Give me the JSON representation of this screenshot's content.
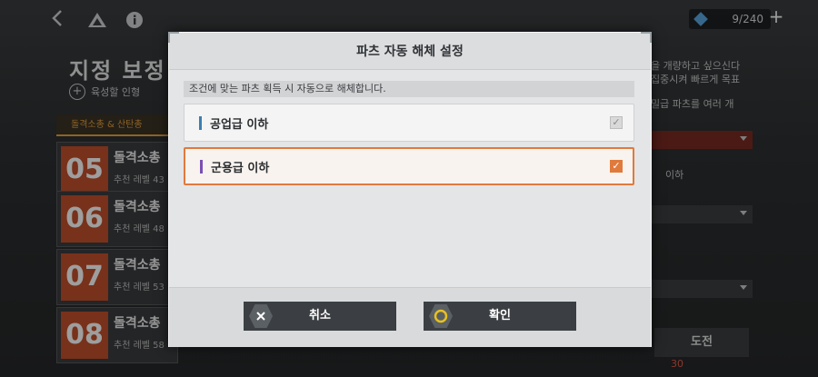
{
  "topbar": {
    "back_icon": "chevron-left-icon",
    "share_icon": "triangle-logo-icon",
    "info_icon": "info-icon",
    "resource_count": "9/240",
    "resource_icon": "gem-icon",
    "plus_icon": "plus-icon"
  },
  "left_panel": {
    "title": "지정 보정",
    "subtitle": "육성할 인형",
    "tab": "돌격소총 & 산탄총",
    "stages": [
      {
        "num": "05",
        "name": "돌격소총",
        "level": "추천 레벨 43"
      },
      {
        "num": "06",
        "name": "돌격소총",
        "level": "추천 레벨 48"
      },
      {
        "num": "07",
        "name": "돌격소총",
        "level": "추천 레벨 53"
      },
      {
        "num": "08",
        "name": "돌격소총",
        "level": "추천 레벨 58"
      }
    ]
  },
  "right_panel": {
    "text1": "을 개량하고 싶으신다",
    "text2": "집중시켜 빠르게 목표",
    "text3": "밀급 파츠를 여러 개",
    "text4": "이하",
    "stamina": "30",
    "start_button": "도전"
  },
  "dialog": {
    "title": "파츠 자동 해체 설정",
    "description": "조건에 맞는 파츠 획득 시 자동으로 해체합니다.",
    "options": [
      {
        "label": "공업급 이하",
        "checked": false,
        "bar_color": "#3a7fb0"
      },
      {
        "label": "군용급 이하",
        "checked": true,
        "bar_color": "#7b4fb3"
      }
    ],
    "cancel_label": "취소",
    "confirm_label": "확인",
    "accent_color": "#e07a3c"
  }
}
